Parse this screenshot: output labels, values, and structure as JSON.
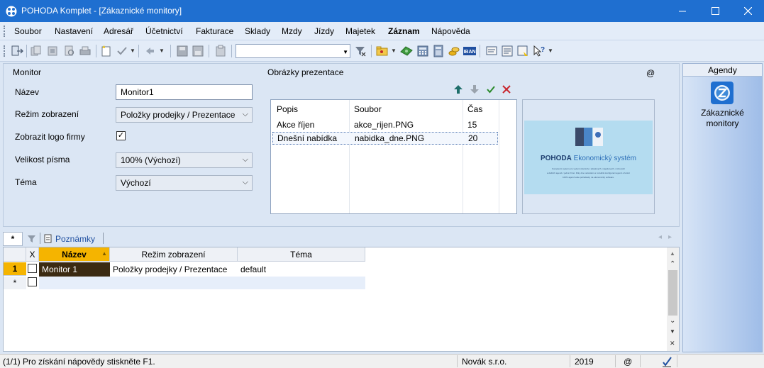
{
  "window": {
    "title": "POHODA Komplet - [Zákaznické monitory]",
    "minimize": "—",
    "maximize": "☐",
    "close": "✕"
  },
  "menu": [
    "Soubor",
    "Nastavení",
    "Adresář",
    "Účetnictví",
    "Fakturace",
    "Sklady",
    "Mzdy",
    "Jízdy",
    "Majetek",
    "Záznam",
    "Nápověda"
  ],
  "menu_active": "Záznam",
  "toolbar": {
    "combo_value": "",
    "icons": [
      "exit-icon",
      "copy-record-icon",
      "copy-record2-icon",
      "print-preview-icon",
      "print-icon",
      "new-record-icon",
      "confirm-icon",
      "back-icon",
      "save-icon",
      "save-all-icon",
      "clipboard-icon",
      "filter-icon",
      "folder-icon",
      "money-icon",
      "calculator-icon",
      "calculator2-icon",
      "coins-icon",
      "iban-icon",
      "mail-icon",
      "note-icon",
      "document-icon",
      "help-icon"
    ]
  },
  "form": {
    "section_title": "Monitor",
    "name_label": "Název",
    "name_value": "Monitor1",
    "mode_label": "Režim zobrazení",
    "mode_value": "Položky prodejky / Prezentace",
    "logo_label": "Zobrazit logo firmy",
    "logo_checked": "✓",
    "font_label": "Velikost písma",
    "font_value": "100% (Výchozí)",
    "theme_label": "Téma",
    "theme_value": "Výchozí",
    "at_symbol": "@"
  },
  "images": {
    "title": "Obrázky prezentace",
    "columns": [
      "Popis",
      "Soubor",
      "Čas"
    ],
    "rows": [
      {
        "popis": "Akce říjen",
        "soubor": "akce_rijen.PNG",
        "cas": "15"
      },
      {
        "popis": "Dnešní nabídka",
        "soubor": "nabidka_dne.PNG",
        "cas": "20"
      }
    ],
    "preview": {
      "brand": "POHODA",
      "subtitle": "Ekonomický systém",
      "caption1": "Komplexní systém pro vedení účetnictví, skladových, majetkových, mzdových",
      "caption2": "a dalších agend v jedné firmě. Díky dne variantám a rozsáhlé konfiguraci agend a funkcí",
      "caption3": "100% agend vaše požadavky na ekonomický software."
    }
  },
  "tabs": {
    "new": "*",
    "notes": "Poznámky",
    "scroll_left": "◂",
    "scroll_right": "▸"
  },
  "grid": {
    "columns": [
      "X",
      "Název",
      "Režim zobrazení",
      "Téma"
    ],
    "rows": [
      {
        "num": "1",
        "name": "Monitor 1",
        "mode": "Položky prodejky / Prezentace",
        "theme": "default"
      }
    ],
    "new_row_marker": "*",
    "scroll_up": "▲",
    "scroll_down": "▼",
    "scroll_first": "⌃",
    "scroll_last": "⌄",
    "scroll_close": "✕"
  },
  "status": {
    "help_text": "(1/1) Pro získání nápovědy stiskněte F1.",
    "company": "Novák s.r.o.",
    "year": "2019",
    "at": "@"
  },
  "agendy": {
    "title": "Agendy",
    "item_label_1": "Zákaznické",
    "item_label_2": "monitory"
  },
  "colors": {
    "titlebar": "#1f6fd0",
    "selected_cell": "#3b2a12",
    "header_sorted": "#f5b400",
    "accent_green": "#2a8a2a",
    "accent_red": "#c8242c"
  }
}
